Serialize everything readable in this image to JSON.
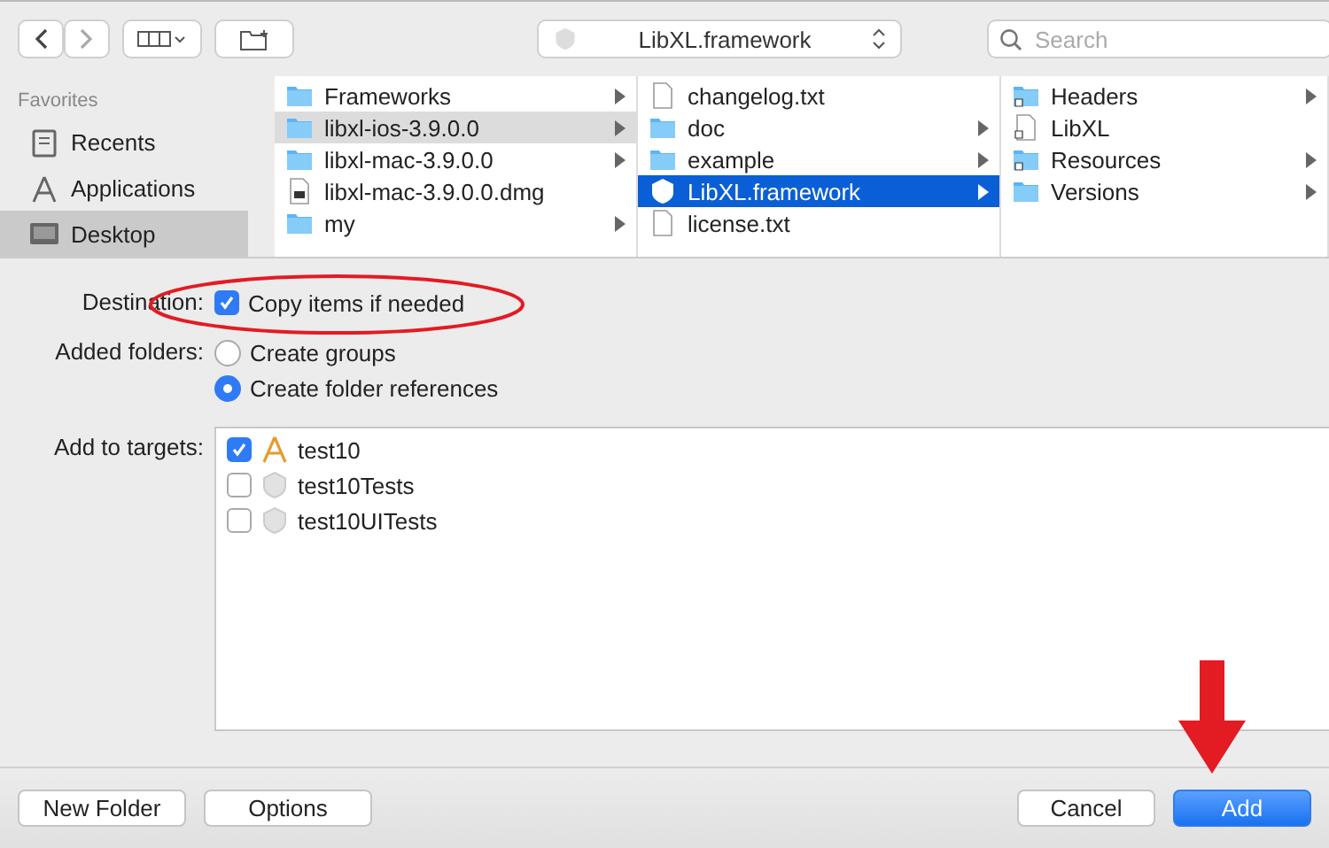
{
  "toolbar": {
    "path_popup": "LibXL.framework",
    "search": {
      "placeholder": "Search"
    }
  },
  "sidebar": {
    "heading": "Favorites",
    "items": [
      {
        "label": "Recents",
        "kind": "recents",
        "selected": false
      },
      {
        "label": "Applications",
        "kind": "apps",
        "selected": false
      },
      {
        "label": "Desktop",
        "kind": "desktop",
        "selected": true
      }
    ]
  },
  "columns": [
    [
      {
        "name": "Frameworks",
        "kind": "folder",
        "selected": false,
        "has_children": true
      },
      {
        "name": "libxl-ios-3.9.0.0",
        "kind": "folder",
        "selected": true,
        "has_children": true
      },
      {
        "name": "libxl-mac-3.9.0.0",
        "kind": "folder",
        "selected": false,
        "has_children": true
      },
      {
        "name": "libxl-mac-3.9.0.0.dmg",
        "kind": "disk",
        "selected": false,
        "has_children": false
      },
      {
        "name": "my",
        "kind": "folder",
        "selected": false,
        "has_children": true
      }
    ],
    [
      {
        "name": "changelog.txt",
        "kind": "file",
        "selected": false,
        "has_children": false
      },
      {
        "name": "doc",
        "kind": "folder",
        "selected": false,
        "has_children": true
      },
      {
        "name": "example",
        "kind": "folder",
        "selected": false,
        "has_children": true
      },
      {
        "name": "LibXL.framework",
        "kind": "framework",
        "selected": true,
        "has_children": true
      },
      {
        "name": "license.txt",
        "kind": "file",
        "selected": false,
        "has_children": false
      }
    ],
    [
      {
        "name": "Headers",
        "kind": "alias_folder",
        "selected": false,
        "has_children": true
      },
      {
        "name": "LibXL",
        "kind": "alias_file",
        "selected": false,
        "has_children": false
      },
      {
        "name": "Resources",
        "kind": "alias_folder",
        "selected": false,
        "has_children": true
      },
      {
        "name": "Versions",
        "kind": "folder",
        "selected": false,
        "has_children": true
      }
    ]
  ],
  "options": {
    "destination": {
      "label": "Destination:",
      "checkbox": {
        "label": "Copy items if needed",
        "checked": true
      }
    },
    "added_folders": {
      "label": "Added folders:",
      "choices": [
        {
          "label": "Create groups",
          "selected": false
        },
        {
          "label": "Create folder references",
          "selected": true
        }
      ]
    },
    "targets": {
      "label": "Add to targets:",
      "items": [
        {
          "label": "test10",
          "kind": "app",
          "checked": true
        },
        {
          "label": "test10Tests",
          "kind": "bundle",
          "checked": false
        },
        {
          "label": "test10UITests",
          "kind": "bundle",
          "checked": false
        }
      ]
    }
  },
  "buttons": {
    "left": [
      "New Folder",
      "Options"
    ],
    "cancel": "Cancel",
    "confirm": "Add"
  }
}
